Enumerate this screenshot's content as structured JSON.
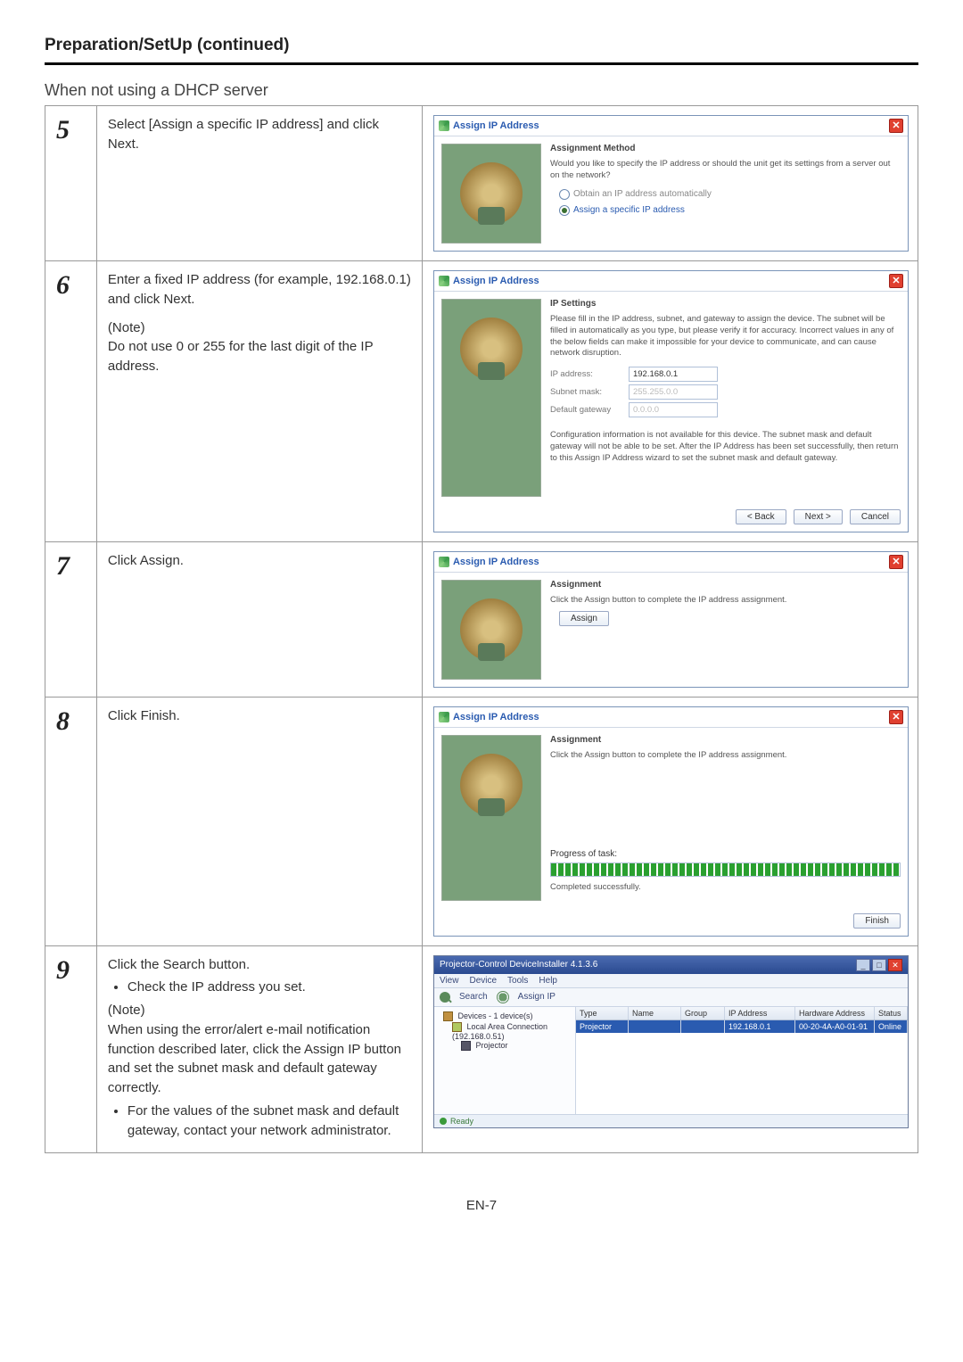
{
  "page": {
    "title": "Preparation/SetUp (continued)",
    "subtitle": "When not using a DHCP server",
    "footer": "EN-7"
  },
  "steps": {
    "s5": {
      "num": "5",
      "desc": "Select [Assign a specific IP address] and click Next."
    },
    "s6": {
      "num": "6",
      "line1": "Enter a fixed IP address (for example, 192.168.0.1) and click Next.",
      "note_label": "(Note)",
      "note_text": "Do not use 0 or 255 for the last digit of the IP address."
    },
    "s7": {
      "num": "7",
      "desc": "Click Assign."
    },
    "s8": {
      "num": "8",
      "desc": "Click Finish."
    },
    "s9": {
      "num": "9",
      "line1": "Click the Search button.",
      "b1": "Check the IP address you set.",
      "note_label": "(Note)",
      "note_text": "When using the error/alert e-mail notification function described later, click the Assign IP button and set the subnet mask and default gateway correctly.",
      "b2": "For the values of the subnet mask and default gateway, contact your network administrator."
    }
  },
  "dlg": {
    "title": "Assign IP Address",
    "close": "✕",
    "method": {
      "heading": "Assignment Method",
      "text": "Would you like to specify the IP address or should the unit get its settings from a server out on the network?",
      "opt_auto": "Obtain an IP address automatically",
      "opt_spec": "Assign a specific IP address"
    },
    "ipset": {
      "heading": "IP Settings",
      "text": "Please fill in the IP address, subnet, and gateway to assign the device. The subnet will be filled in automatically as you type, but please verify it for accuracy. Incorrect values in any of the below fields can make it impossible for your device to communicate, and can cause network disruption.",
      "lbl_ip": "IP address:",
      "val_ip": "192.168.0.1",
      "lbl_mask": "Subnet mask:",
      "val_mask": "255.255.0.0",
      "lbl_gw": "Default gateway",
      "val_gw": "0.0.0.0",
      "warn": "Configuration information is not available for this device. The subnet mask and default gateway will not be able to be set. After the IP Address has been set successfully, then return to this Assign IP Address wizard to set the subnet mask and default gateway."
    },
    "assign": {
      "heading": "Assignment",
      "text": "Click the Assign button to complete the IP address assignment.",
      "btn": "Assign"
    },
    "finish": {
      "heading": "Assignment",
      "text": "Click the Assign button to complete the IP address assignment.",
      "progress_lbl": "Progress of task:",
      "done": "Completed successfully.",
      "btn": "Finish"
    },
    "btn_back": "< Back",
    "btn_next": "Next >",
    "btn_cancel": "Cancel"
  },
  "app": {
    "title": "Projector-Control DeviceInstaller 4.1.3.6",
    "menu": {
      "view": "View",
      "device": "Device",
      "tools": "Tools",
      "help": "Help"
    },
    "tool": {
      "search": "Search",
      "assign": "Assign IP"
    },
    "tree": {
      "root": "Devices - 1 device(s)",
      "lan": "Local Area Connection (192.168.0.51)",
      "proj": "Projector"
    },
    "grid": {
      "h_type": "Type",
      "h_name": "Name",
      "h_group": "Group",
      "h_ip": "IP Address",
      "h_hw": "Hardware Address",
      "h_status": "Status",
      "r_type": "Projector",
      "r_name": "",
      "r_group": "",
      "r_ip": "192.168.0.1",
      "r_hw": "00-20-4A-A0-01-91",
      "r_status": "Online"
    },
    "status": "Ready"
  }
}
